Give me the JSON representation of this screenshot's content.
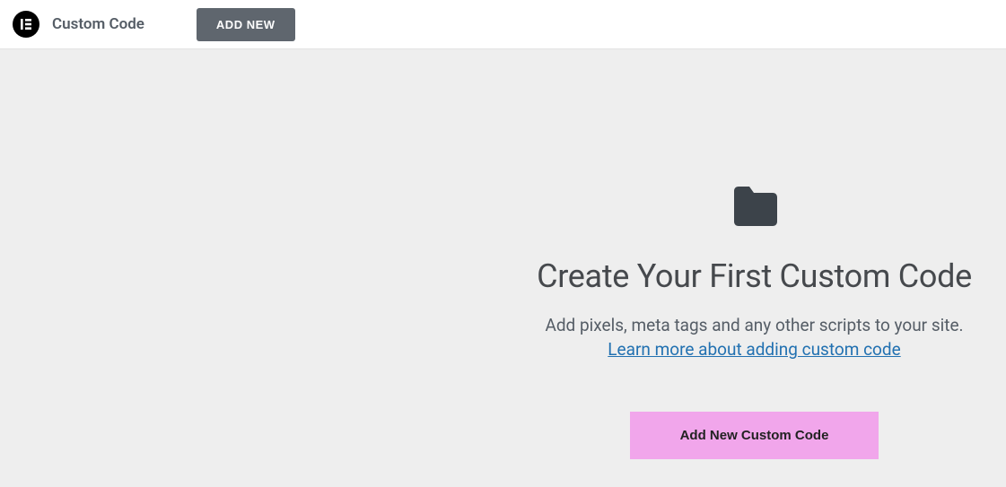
{
  "header": {
    "title": "Custom Code",
    "add_new_label": "ADD NEW"
  },
  "empty_state": {
    "heading": "Create Your First Custom Code",
    "description": "Add pixels, meta tags and any other scripts to your site.",
    "link_text": "Learn more about adding custom code",
    "cta_label": "Add New Custom Code"
  }
}
